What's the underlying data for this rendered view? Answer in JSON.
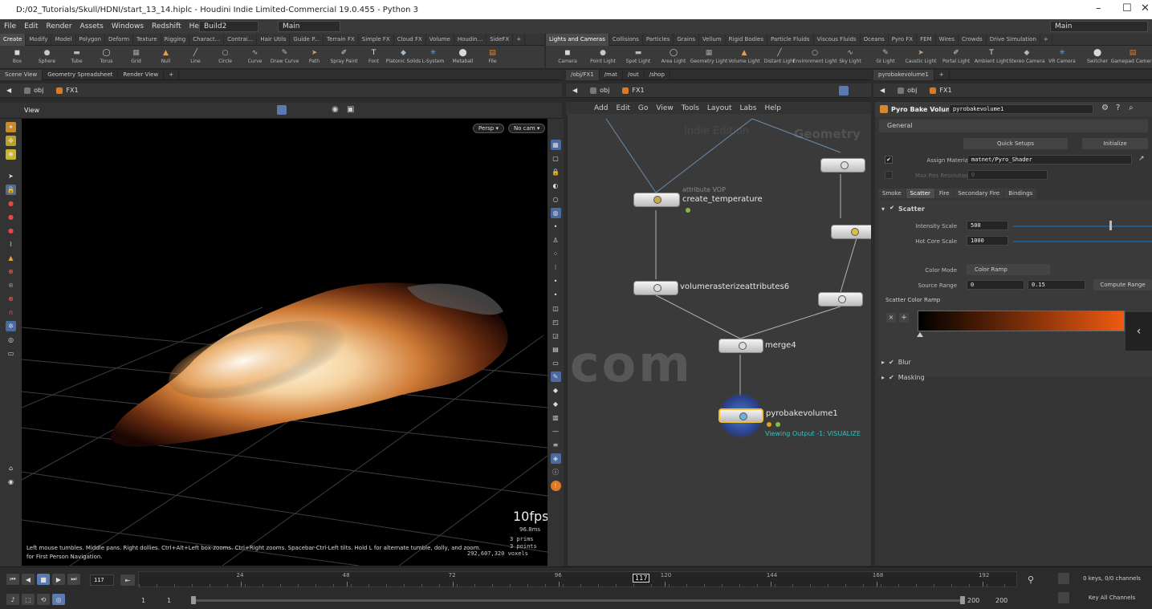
{
  "window": {
    "title": "D:/02_Tutorials/Skull/HDNI/start_13_14.hiplc - Houdini Indie Limited-Commercial 19.0.455 - Python 3",
    "min": "–",
    "max": "☐",
    "close": "✕"
  },
  "menu": [
    "File",
    "Edit",
    "Render",
    "Assets",
    "Windows",
    "Redshift",
    "Help"
  ],
  "desktop": {
    "build": "Build2",
    "main": "Main",
    "right_main": "Main"
  },
  "shelf_left": {
    "tabs": [
      "Create",
      "Modify",
      "Model",
      "Polygon",
      "Deform",
      "Texture",
      "Rigging",
      "Charact...",
      "Contrai...",
      "Hair Utils",
      "Guide P...",
      "Terrain FX",
      "Simple FX",
      "Cloud FX",
      "Volume",
      "Houdin...",
      "SideFX"
    ],
    "tools": [
      "Box",
      "Sphere",
      "Tube",
      "Torus",
      "Grid",
      "Null",
      "Line",
      "Circle",
      "Curve",
      "Draw Curve",
      "Path",
      "Spray Paint",
      "Font",
      "Platonic Solids",
      "L-System",
      "Metaball",
      "File"
    ]
  },
  "shelf_right": {
    "tabs": [
      "Lights and Cameras",
      "Collisions",
      "Particles",
      "Grains",
      "Vellum",
      "Rigid Bodies",
      "Particle Fluids",
      "Viscous Fluids",
      "Oceans",
      "Pyro FX",
      "FEM",
      "Wires",
      "Crowds",
      "Drive Simulation"
    ],
    "tools": [
      "Camera",
      "Point Light",
      "Spot Light",
      "Area Light",
      "Geometry Light",
      "Volume Light",
      "Distant Light",
      "Environment Light",
      "Sky Light",
      "GI Light",
      "Caustic Light",
      "Portal Light",
      "Ambient Light",
      "Stereo Camera",
      "VR Camera",
      "Switcher",
      "Gamepad Camera"
    ]
  },
  "left_pane": {
    "tabs": [
      "Scene View",
      "Geometry Spreadsheet",
      "Render View"
    ],
    "path": [
      "obj",
      "FX1"
    ],
    "view_label": "View",
    "persp": "Persp ▾",
    "cam": "No cam ▾",
    "fps": "10fps",
    "ms": "96.8ms",
    "stats": [
      "3  prims",
      "3 points",
      "292,607,320 voxels"
    ],
    "help": "Left mouse tumbles. Middle pans. Right dollies. Ctrl+Alt+Left box-zooms. Ctrl+Right zooms. Spacebar-Ctrl-Left tilts. Hold L for alternate tumble, dolly, and zoom.",
    "help2": "for First Person Navigation."
  },
  "net_pane": {
    "tabs": [
      "/obj/FX1",
      "/mat",
      "/out",
      "/shop"
    ],
    "path": [
      "obj",
      "FX1"
    ],
    "menu": [
      "Add",
      "Edit",
      "Go",
      "View",
      "Tools",
      "Layout",
      "Labs",
      "Help"
    ],
    "watermark1": "Indie Edition",
    "watermark2": "Geometry",
    "nodes": {
      "create_temp": "create_temperature",
      "create_temp_type": "attribute VOP",
      "vra": "volumerasterizeattributes6",
      "merge": "merge4",
      "pyro": "pyrobakevolume1",
      "viewing": "Viewing Output -1: VISUALIZE"
    },
    "site_watermark": "vfx.com"
  },
  "params": {
    "tab": "pyrobakevolume1",
    "path": [
      "obj",
      "FX1"
    ],
    "node_type": "Pyro Bake Volume",
    "node_name": "pyrobakevolume1",
    "general": "General",
    "quick_setups": "Quick Setups",
    "initialize": "Initialize",
    "assign_material_label": "Assign Material",
    "assign_material_value": "matnet/Pyro_Shader",
    "max_res_label": "Max Res Resolution",
    "max_res_value": "0",
    "tabs": [
      "Smoke",
      "Scatter",
      "Fire",
      "Secondary Fire",
      "Bindings"
    ],
    "scatter": "Scatter",
    "intensity_label": "Intensity Scale",
    "intensity_value": "500",
    "hotcore_label": "Hot Core Scale",
    "hotcore_value": "1000",
    "color_mode_label": "Color Mode",
    "color_mode_value": "Color Ramp",
    "source_range_label": "Source Range",
    "source_min": "0",
    "source_max": "0.15",
    "compute_range": "Compute Range",
    "ramp_label": "Scatter Color Ramp",
    "blur": "Blur",
    "masking": "Masking",
    "ramp_colors": [
      "#000000",
      "#f05a12"
    ]
  },
  "timeline": {
    "frame": "117",
    "current": "117",
    "ticks": [
      "24",
      "48",
      "72",
      "96",
      "120",
      "144",
      "168",
      "192"
    ],
    "start": "1",
    "start2": "1",
    "end": "200",
    "end2": "200",
    "keys": "0 keys, 0/0 channels",
    "key_all": "Key All Channels",
    "progress": 0.57
  }
}
